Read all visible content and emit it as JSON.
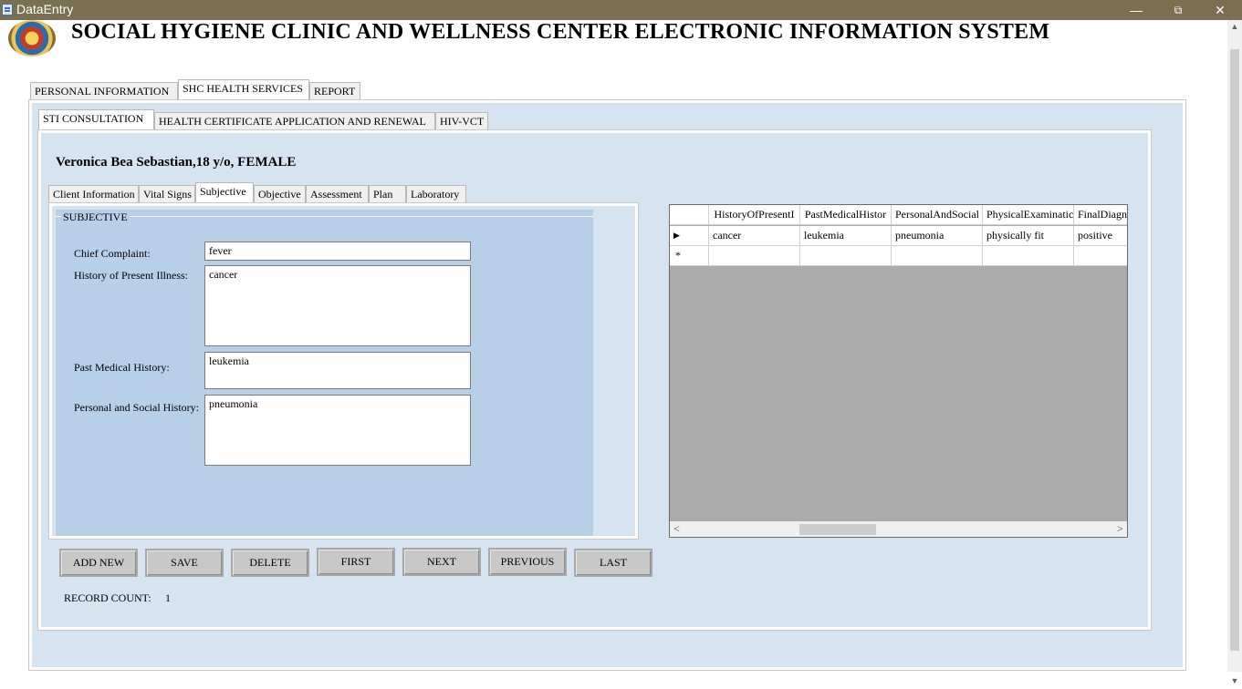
{
  "window": {
    "title": "DataEntry",
    "minimize_icon": "minimize-icon",
    "maximize_icon": "restore-icon",
    "close_icon": "close-icon"
  },
  "header": {
    "title": "SOCIAL HYGIENE CLINIC AND WELLNESS CENTER ELECTRONIC INFORMATION SYSTEM"
  },
  "main_tabs": [
    "PERSONAL INFORMATION",
    "SHC HEALTH SERVICES",
    "REPORT"
  ],
  "service_tabs": [
    "STI CONSULTATION",
    "HEALTH CERTIFICATE APPLICATION AND RENEWAL",
    "HIV-VCT"
  ],
  "patient": {
    "summary": "Veronica Bea Sebastian,18 y/o, FEMALE"
  },
  "record_tabs": [
    "Client Information",
    "Vital Signs",
    "Subjective",
    "Objective",
    "Assessment",
    "Plan",
    "Laboratory"
  ],
  "subjective": {
    "group_title": "SUBJECTIVE",
    "chief_complaint_label": "Chief Complaint:",
    "chief_complaint": "fever",
    "hpi_label": "History of Present Illness:",
    "hpi": "cancer",
    "pmh_label": "Past Medical History:",
    "pmh": "leukemia",
    "psh_label": "Personal and Social History:",
    "psh": "pneumonia"
  },
  "grid": {
    "columns": [
      "HistoryOfPresentI",
      "PastMedicalHistor",
      "PersonalAndSocial",
      "PhysicalExaminatic",
      "FinalDiagn"
    ],
    "row": [
      "cancer",
      "leukemia",
      "pneumonia",
      "physically fit",
      "positive"
    ],
    "current_row_marker": "▶",
    "new_row_marker": "*",
    "scroll_left": "<",
    "scroll_right": ">"
  },
  "buttons": {
    "add_new": "ADD NEW",
    "save": "SAVE",
    "delete": "DELETE",
    "first": "FIRST",
    "next": "NEXT",
    "previous": "PREVIOUS",
    "last": "LAST"
  },
  "record_count": {
    "label": "RECORD COUNT:",
    "value": "1"
  },
  "colors": {
    "titlebar": "#7a7051",
    "outer_panel": "#d6e3f0",
    "group_box": "#b8cfe8",
    "grid_bg": "#ababab"
  }
}
